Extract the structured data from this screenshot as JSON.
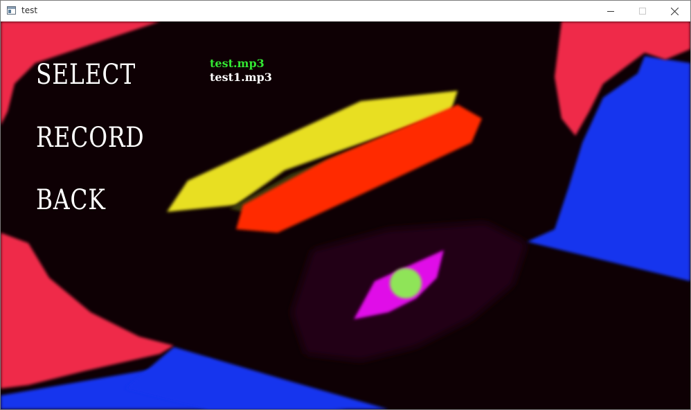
{
  "window": {
    "title": "test",
    "controls": [
      "minimize",
      "maximize",
      "close"
    ]
  },
  "menu": {
    "items": [
      {
        "label": "SELECT"
      },
      {
        "label": "RECORD"
      },
      {
        "label": "BACK"
      }
    ]
  },
  "file_list": {
    "items": [
      {
        "name": "test.mp3",
        "selected": true
      },
      {
        "name": "test1.mp3",
        "selected": false
      }
    ]
  },
  "colors": {
    "selected_text": "#33e633",
    "menu_text": "#ffffff",
    "background_black": "#0e0004",
    "pink": "#ef2a4a",
    "blue": "#1434ee",
    "yellow": "#e8df20",
    "red": "#ff2a00",
    "magenta": "#e010e8",
    "green": "#8fe458"
  },
  "icons": {
    "app": "app-window-icon",
    "minimize": "minimize-icon",
    "maximize": "maximize-icon",
    "close": "close-icon"
  }
}
